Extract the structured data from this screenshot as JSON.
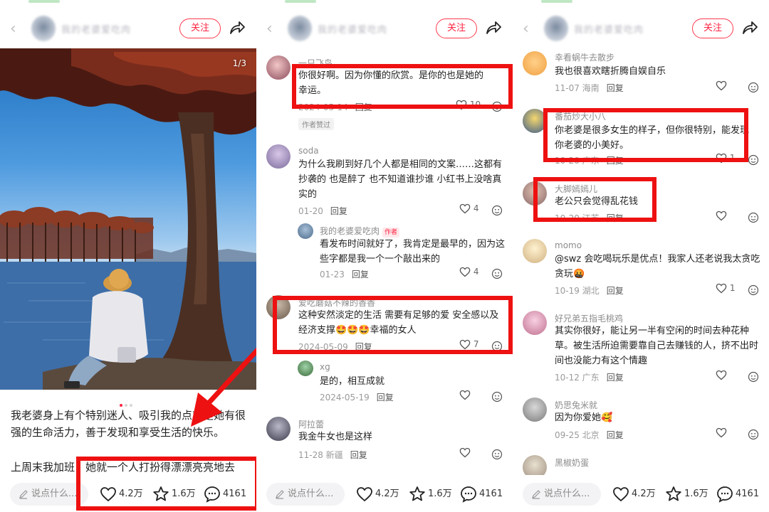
{
  "colors": {
    "accent": "#ff2442",
    "annotation_red": "#ee1111",
    "text": "#222222",
    "meta": "#9a9a9a"
  },
  "header": {
    "follow_label": "关注",
    "author_name_blurred": "我的老婆爱吃肉"
  },
  "post": {
    "page_indicator": "1/3",
    "text_line1": "我老婆身上有个特别迷人、吸引我的点就是她有很强的生命活力，善于发现和享受生活的快乐。",
    "text_line2": "上周末我加班，她就一个人打扮得漂漂亮亮地去"
  },
  "bottom_bar": {
    "comment_placeholder": "说点什么...",
    "likes": "4.2万",
    "stars": "1.6万",
    "comments": "4161"
  },
  "panel2": {
    "comments": [
      {
        "user": "一只飞鸟",
        "text": "你很好啊。因为你懂的欣赏。是你的也是她的幸运。",
        "date": "2024-05-14",
        "reply": "回复",
        "likes": "10",
        "tag": "作者赞过"
      },
      {
        "user": "soda",
        "text": "为什么我刷到好几个人都是相同的文案……这都有抄袭的 也是醉了 也不知道谁抄谁 小红书上没啥真实的",
        "date": "01-20",
        "reply": "回复",
        "likes": "4"
      },
      {
        "user": "我的老婆爱吃肉",
        "badge": "作者",
        "text": "看发布时间就好了，我肯定是最早的，因为这些字都是我一个一个敲出来的",
        "date": "01-23",
        "reply": "回复",
        "likes": "4"
      },
      {
        "user": "爱吃蘑菇不辣的香香",
        "text": "这种安然淡定的生活 需要有足够的爱 安全感以及经济支撑🤩🤩🤩幸福的女人",
        "date": "2024-05-09",
        "reply": "回复",
        "likes": "7"
      },
      {
        "user": "xg",
        "text": "是的，相互成就",
        "date": "2024-05-19",
        "reply": "回复",
        "likes": ""
      },
      {
        "user": "阿拉蕾",
        "text": "我金牛女也是这样",
        "date": "11-28 新疆",
        "reply": "回复",
        "likes": ""
      }
    ]
  },
  "panel3": {
    "comments": [
      {
        "user": "幸看蜗牛去散步",
        "text": "我也很喜欢瞎折腾自娱自乐",
        "date": "11-07 海南",
        "reply": "回复",
        "likes": ""
      },
      {
        "user": "番茄炒大小八",
        "text": "你老婆是很多女生的样子，但你很特别，能发现你老婆的小美好。",
        "date": "10-20 广东",
        "reply": "回复",
        "likes": "1"
      },
      {
        "user": "大脚嫣嫣儿",
        "text": "老公只会觉得乱花钱",
        "date": "10-20 江苏",
        "reply": "回复",
        "likes": ""
      },
      {
        "user": "momo",
        "text": "@swz 会吃喝玩乐是优点！我家人还老说我太贪吃贪玩🤬",
        "date": "10-19 湖北",
        "reply": "回复",
        "likes": "1"
      },
      {
        "user": "好兄弟五指毛桃鸡",
        "text": "其实你很好，能让另一半有空闲的时间去种花种草。被生活所迫需要靠自己去赚钱的人，挤不出时间也没能力有这个情趣",
        "date": "10-12 广东",
        "reply": "回复",
        "likes": ""
      },
      {
        "user": "奶思兔米就",
        "text": "因为你爱她🥰",
        "date": "09-25 北京",
        "reply": "回复",
        "likes": ""
      },
      {
        "user": "黑椒奶蛋",
        "text": "",
        "date": "",
        "reply": "",
        "likes": ""
      }
    ]
  }
}
